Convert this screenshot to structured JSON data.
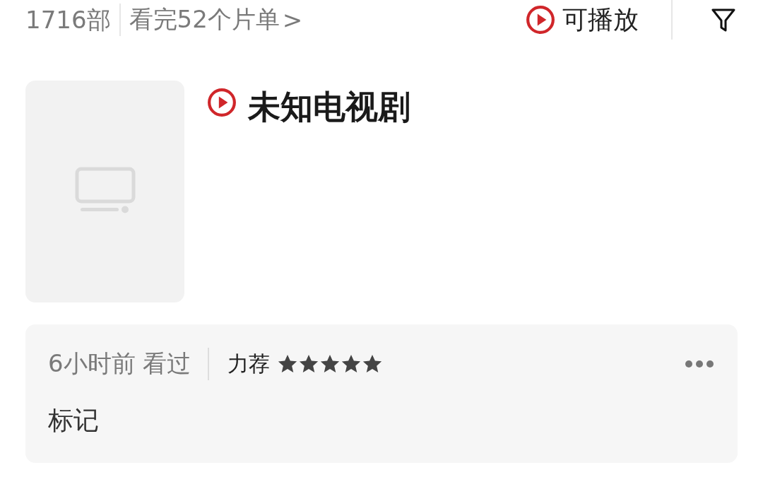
{
  "toolbar": {
    "count": "1716部",
    "lists_link": "看完52个片单",
    "lists_chevron": ">",
    "playable_filter": "可播放"
  },
  "item": {
    "title": "未知电视剧",
    "playable": true,
    "record": {
      "time": "6小时前 看过",
      "rating_label": "力荐",
      "stars": 5,
      "note": "标记"
    }
  }
}
